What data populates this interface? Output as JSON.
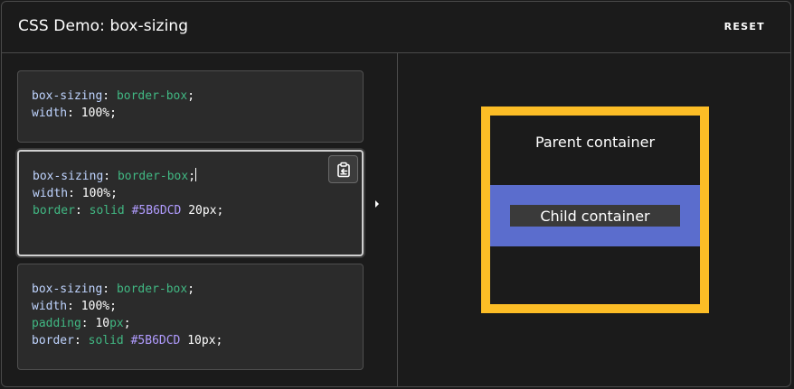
{
  "header": {
    "title": "CSS Demo: box-sizing",
    "reset_label": "RESET"
  },
  "colors": {
    "accent_border_parent": "#FCBD26",
    "child_border": "#5B6DCD",
    "background": "#1B1B1B",
    "code_box_bg": "#2B2B2B"
  },
  "examples": [
    {
      "selected": false,
      "lines": [
        {
          "prop": "box-sizing",
          "colon": ": ",
          "value": "border-box",
          "end": ";"
        },
        {
          "prop": "width",
          "colon": ": ",
          "value": "100%",
          "end": ";"
        }
      ]
    },
    {
      "selected": true,
      "lines": [
        {
          "prop": "box-sizing",
          "colon": ": ",
          "value": "border-box",
          "end": ";"
        },
        {
          "prop": "width",
          "colon": ": ",
          "value": "100%",
          "end": ";"
        },
        {
          "prop": "border",
          "colon": ": ",
          "kw": "solid",
          "hex": "#5B6DCD",
          "num": "20px",
          "end": ";"
        }
      ],
      "copy_icon": "clipboard-copy-icon"
    },
    {
      "selected": false,
      "lines": [
        {
          "prop": "box-sizing",
          "colon": ": ",
          "value": "border-box",
          "end": ";"
        },
        {
          "prop": "width",
          "colon": ": ",
          "value": "100%",
          "end": ";"
        },
        {
          "prop": "padding",
          "colon": ": ",
          "num": "10",
          "unit": "px",
          "end": ";"
        },
        {
          "prop": "border",
          "colon": ": ",
          "kw": "solid",
          "hex": "#5B6DCD",
          "num": "10px",
          "end": ";"
        }
      ]
    }
  ],
  "output": {
    "parent_label": "Parent container",
    "child_label": "Child container"
  }
}
